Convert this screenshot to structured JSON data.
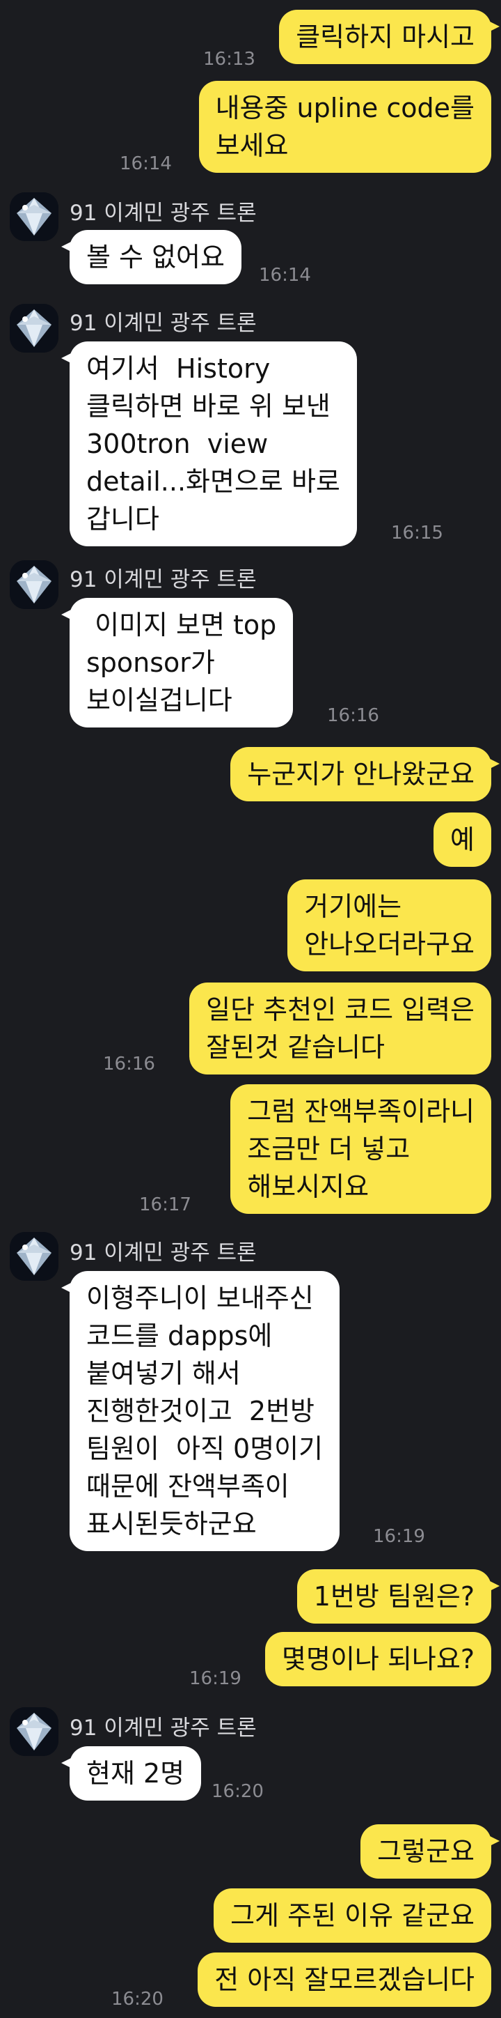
{
  "contact": {
    "name": "91 이계민 광주 트론",
    "avatar_icon": "diamond-avatar-icon"
  },
  "colors": {
    "background": "#1b1c20",
    "my_bubble": "#fbe64d",
    "their_bubble": "#ffffff",
    "timestamp": "#8c8c92"
  },
  "messages": [
    {
      "from": "me",
      "text": "클릭하지 마시고",
      "time": "16:13"
    },
    {
      "from": "me",
      "text": "내용중 upline code를\n보세요",
      "time": "16:14"
    },
    {
      "from": "them",
      "text": "볼 수 없어요",
      "time": "16:14"
    },
    {
      "from": "them",
      "text": "여기서  History\n클릭하면 바로 위 보낸\n300tron  view\ndetail...화면으로 바로\n갑니다",
      "time": "16:15"
    },
    {
      "from": "them",
      "text": " 이미지 보면 top\nsponsor가\n보이실겁니다",
      "time": "16:16"
    },
    {
      "from": "me",
      "text": "누군지가 안나왔군요",
      "time": ""
    },
    {
      "from": "me",
      "text": "예",
      "time": ""
    },
    {
      "from": "me",
      "text": "거기에는\n안나오더라구요",
      "time": ""
    },
    {
      "from": "me",
      "text": "일단 추천인 코드 입력은\n잘된것 같습니다",
      "time": "16:16"
    },
    {
      "from": "me",
      "text": "그럼 잔액부족이라니\n조금만 더 넣고\n해보시지요",
      "time": "16:17"
    },
    {
      "from": "them",
      "text": "이형주니이 보내주신\n코드를 dapps에\n붙여넣기 해서\n진행한것이고  2번방\n팀원이  아직 0명이기\n때문에 잔액부족이\n표시된듯하군요",
      "time": "16:19"
    },
    {
      "from": "me",
      "text": "1번방 팀원은?",
      "time": ""
    },
    {
      "from": "me",
      "text": "몇명이나 되나요?",
      "time": "16:19"
    },
    {
      "from": "them",
      "text": "현재 2명",
      "time": "16:20"
    },
    {
      "from": "me",
      "text": "그렇군요",
      "time": ""
    },
    {
      "from": "me",
      "text": "그게 주된 이유 같군요",
      "time": ""
    },
    {
      "from": "me",
      "text": "전 아직 잘모르겠습니다",
      "time": "16:20"
    }
  ]
}
